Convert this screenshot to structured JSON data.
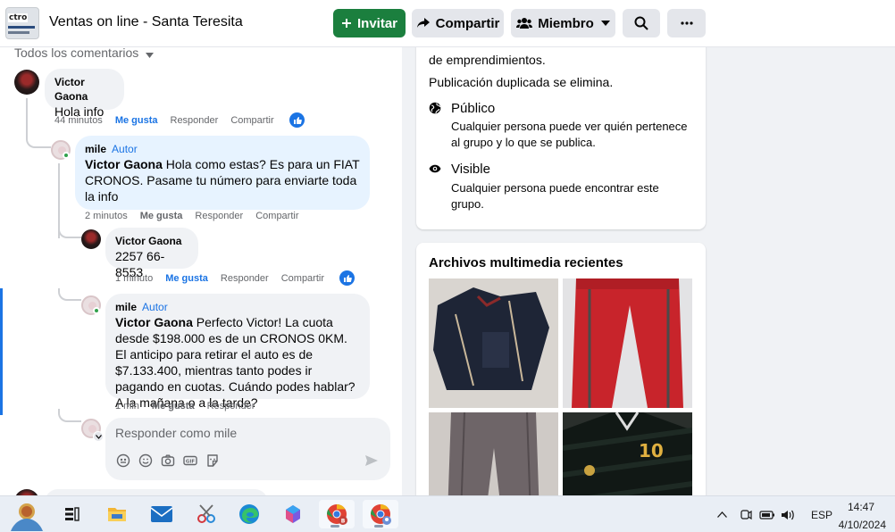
{
  "header": {
    "group_name": "Ventas on line - Santa Teresita",
    "thumb_text": "ctro",
    "invite_label": "Invitar",
    "share_label": "Compartir",
    "member_label": "Miembro"
  },
  "comments": {
    "filter_label": "Todos los comentarios",
    "items": [
      {
        "author": "Victor Gaona",
        "text": "Hola info",
        "time": "44 minutos",
        "like": "Me gusta",
        "reply": "Responder",
        "share": "Compartir"
      },
      {
        "author": "mile",
        "badge": "Autor",
        "mention": "Victor Gaona",
        "text": " Hola como estas? Es para un FIAT CRONOS. Pasame tu número para enviarte toda la info",
        "time": "2 minutos",
        "like": "Me gusta",
        "reply": "Responder",
        "share": "Compartir"
      },
      {
        "author": "Victor Gaona",
        "text": "2257 66-8553",
        "time": "1 minuto",
        "like": "Me gusta",
        "reply": "Responder",
        "share": "Compartir"
      },
      {
        "author": "mile",
        "badge": "Autor",
        "mention": "Victor Gaona",
        "text": " Perfecto Victor! La cuota desde $198.000 es de un CRONOS 0KM. El anticipo para retirar el auto es de $7.133.400, mientras tanto podes ir pagando en cuotas. Cuándo podes hablar? A la mañana o a la tarde?",
        "time": "1 min",
        "like": "Me gusta",
        "reply": "Responder"
      }
    ],
    "composer_placeholder": "Responder como mile"
  },
  "about": {
    "line1": "de emprendimientos.",
    "line2": "Publicación duplicada se elimina.",
    "public_title": "Público",
    "public_desc": "Cualquier persona puede ver quién pertenece al grupo y lo que se publica.",
    "visible_title": "Visible",
    "visible_desc": "Cualquier persona puede encontrar este grupo."
  },
  "media": {
    "title": "Archivos multimedia recientes"
  },
  "taskbar": {
    "lang": "ESP",
    "time": "14:47",
    "date": "4/10/2024"
  },
  "colors": {
    "accent_blue": "#1b74e4",
    "invite_green": "#1b7f3e"
  }
}
